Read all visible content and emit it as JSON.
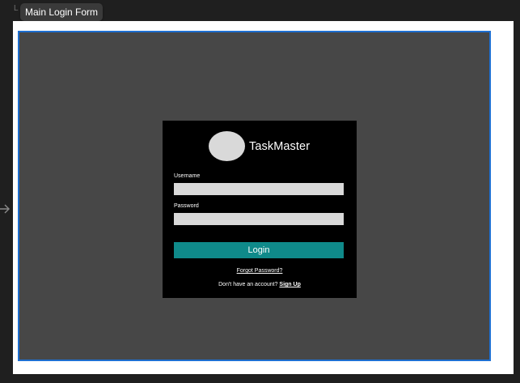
{
  "canvas": {
    "frame_stub_letter": "L",
    "frame_name": "Main Login Form"
  },
  "login": {
    "app_name": "TaskMaster",
    "username_label": "Username",
    "username_value": "",
    "password_label": "Password",
    "password_value": "",
    "login_button": "Login",
    "forgot_password": "Forgot Password?",
    "no_account_text": "Don't have an account? ",
    "sign_up": "Sign Up"
  },
  "colors": {
    "canvas_bg": "#1f1f1f",
    "frame_bg": "#474747",
    "selection": "#1e6fd1",
    "card_bg": "#000000",
    "input_bg": "#d9d9d9",
    "accent": "#0f8a8a"
  },
  "icons": {
    "frame_arrow": "arrow-right-icon",
    "logo": "logo-avatar-circle"
  }
}
